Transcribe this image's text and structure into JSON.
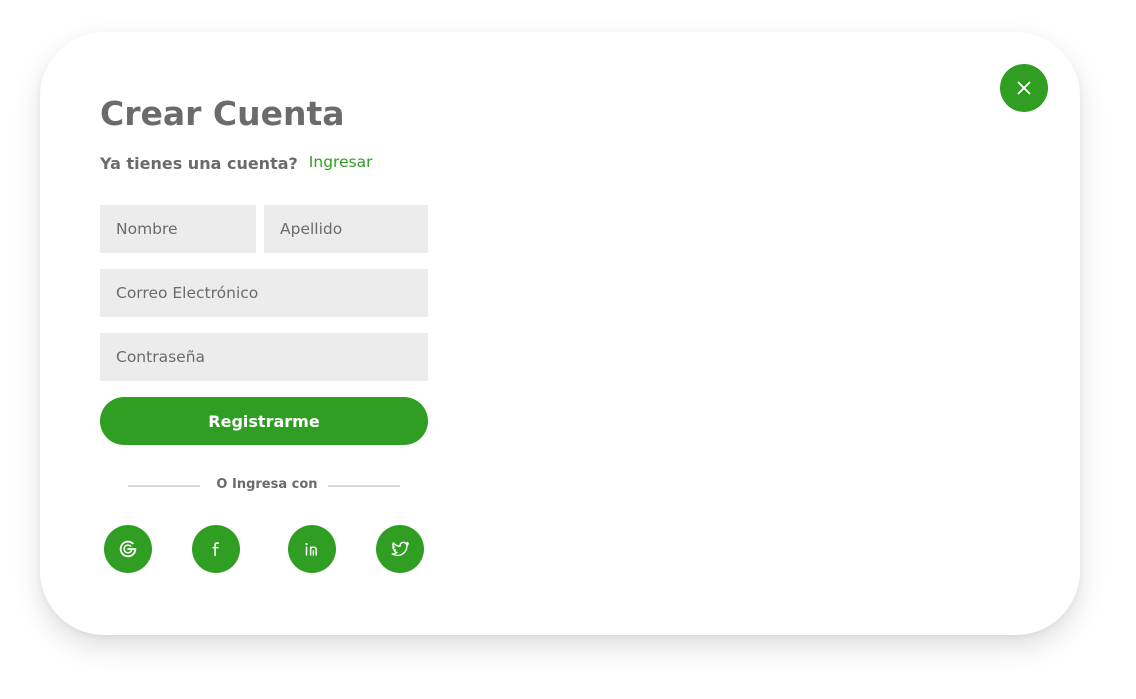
{
  "modal": {
    "title": "Crear Cuenta",
    "has_account_text": "Ya tienes una cuenta?",
    "login_link": "Ingresar",
    "close_icon": "close-icon"
  },
  "form": {
    "first_name_placeholder": "Nombre",
    "last_name_placeholder": "Apellido",
    "email_placeholder": "Correo Electrónico",
    "password_placeholder": "Contraseña",
    "submit_label": "Registrarme"
  },
  "social": {
    "divider_text": "O Ingresa con",
    "providers": [
      {
        "icon": "google-icon"
      },
      {
        "icon": "facebook-icon"
      },
      {
        "icon": "linkedin-icon"
      },
      {
        "icon": "twitter-icon"
      }
    ]
  },
  "colors": {
    "accent": "#2f9e23",
    "text": "#6b6b6b",
    "field_bg": "#ececec"
  }
}
